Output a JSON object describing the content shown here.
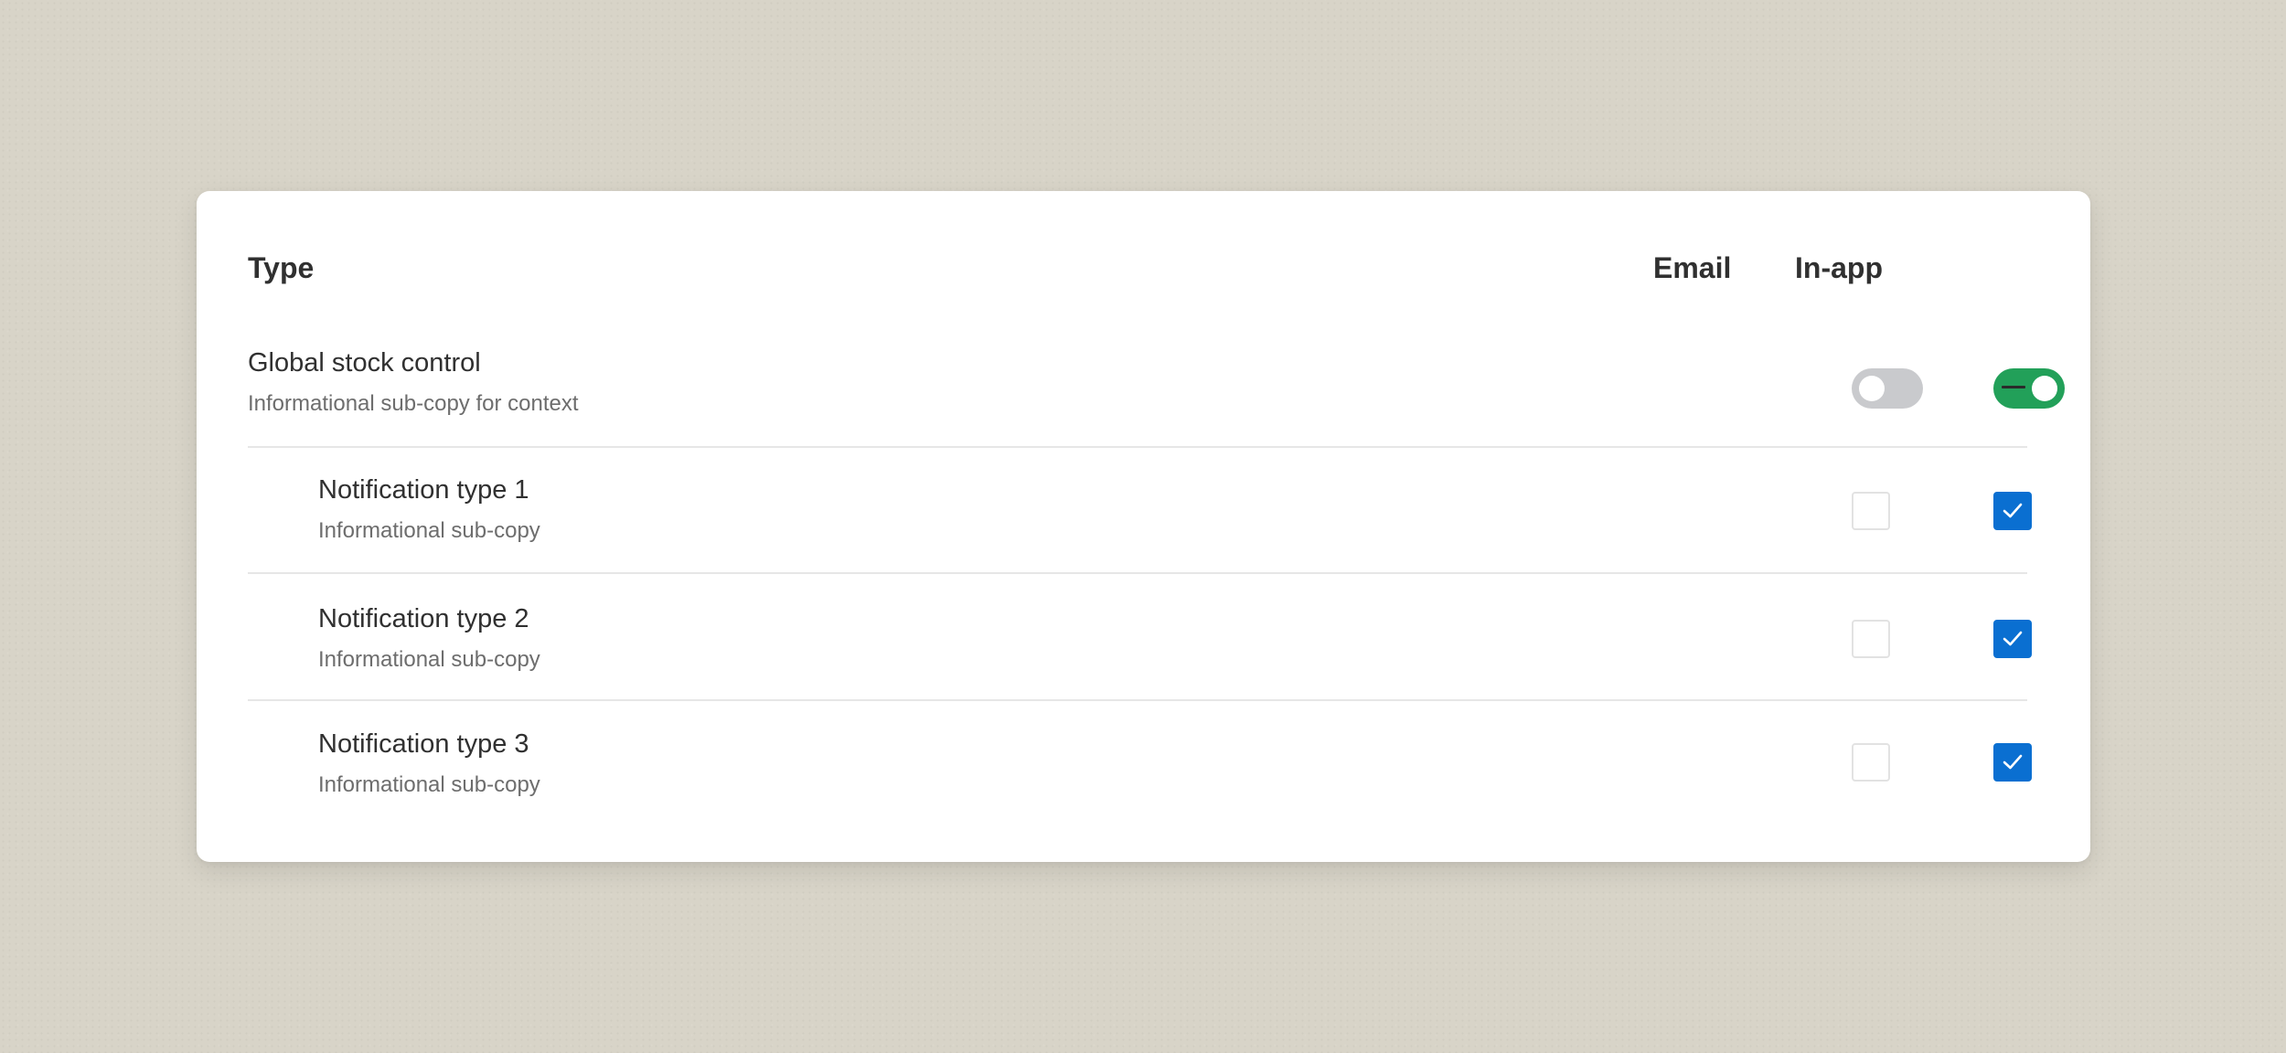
{
  "table": {
    "headers": {
      "type": "Type",
      "email": "Email",
      "inapp": "In-app"
    },
    "group": {
      "title": "Global stock control",
      "subtitle": "Informational sub-copy for context",
      "email_enabled": false,
      "inapp_enabled": true,
      "collapse_icon": "minus-icon"
    },
    "items": [
      {
        "title": "Notification type 1",
        "subtitle": "Informational sub-copy",
        "email_checked": false,
        "inapp_checked": true
      },
      {
        "title": "Notification type 2",
        "subtitle": "Informational sub-copy",
        "email_checked": false,
        "inapp_checked": true
      },
      {
        "title": "Notification type 3",
        "subtitle": "Informational sub-copy",
        "email_checked": false,
        "inapp_checked": true
      }
    ]
  },
  "colors": {
    "toggle_on": "#22a059",
    "toggle_off": "#c9cacd",
    "checkbox_checked": "#0a6fd1"
  }
}
